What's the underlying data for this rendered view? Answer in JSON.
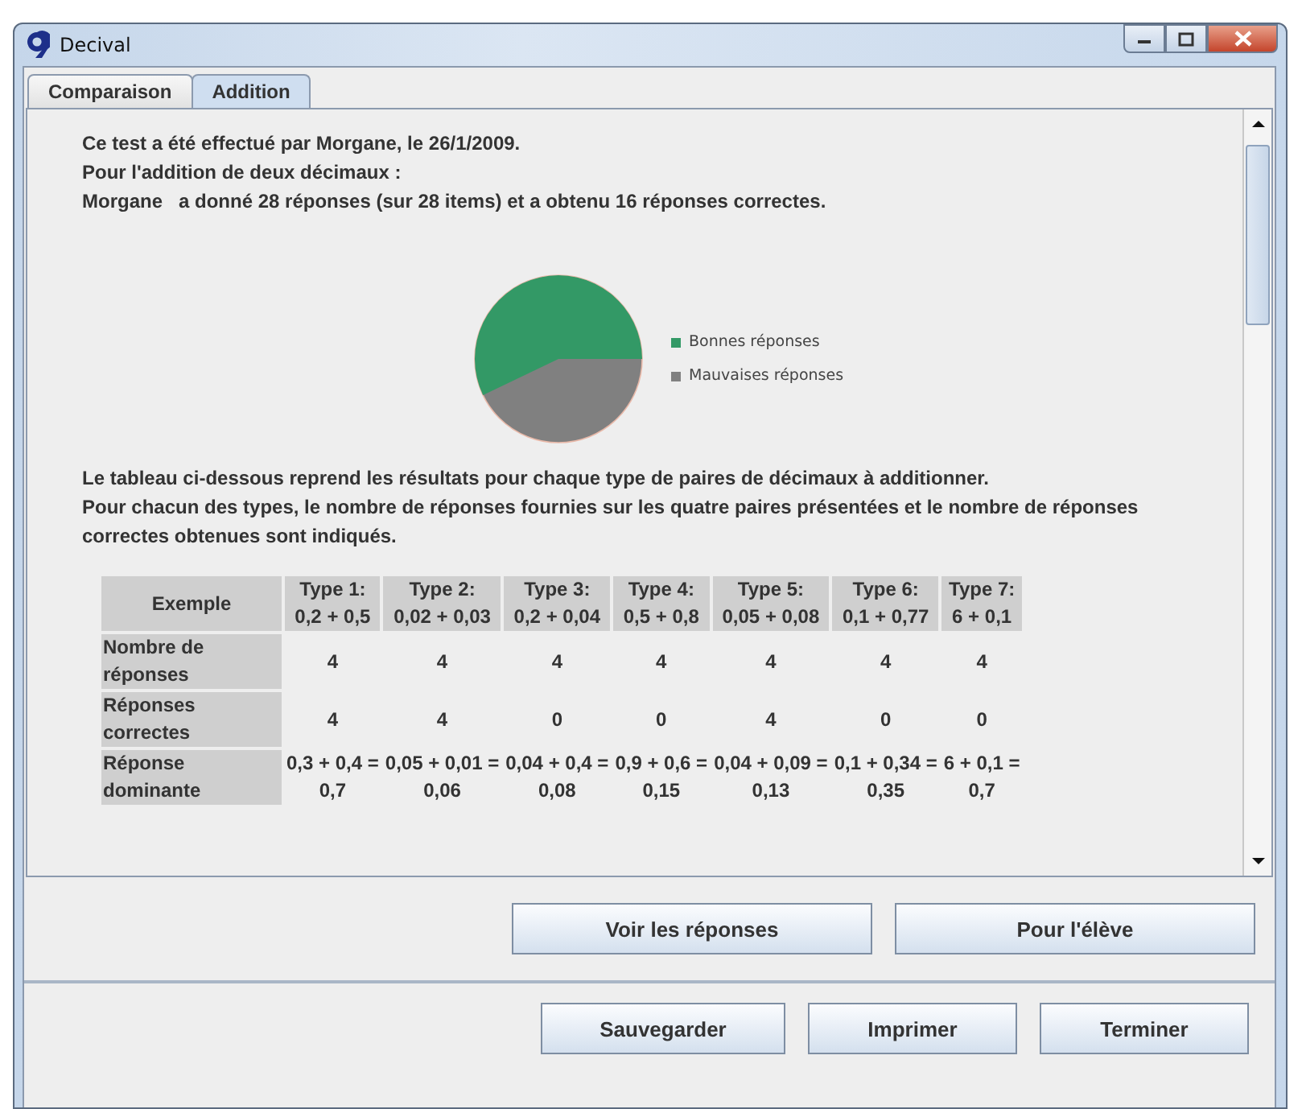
{
  "window": {
    "title": "Decival"
  },
  "tabs": [
    {
      "label": "Comparaison",
      "selected": false
    },
    {
      "label": "Addition",
      "selected": true
    }
  ],
  "intro": [
    "Ce test a été effectué par Morgane, le 26/1/2009.",
    "Pour l'addition de deux décimaux :",
    "Morgane   a donné 28 réponses (sur 28 items) et a obtenu 16 réponses correctes."
  ],
  "pie": {
    "legend": [
      {
        "label": "Bonnes réponses",
        "color": "#339966"
      },
      {
        "label": "Mauvaises réponses",
        "color": "#808080"
      }
    ]
  },
  "description": "Le tableau ci-dessous reprend les résultats pour chaque type de paires de décimaux à additionner.\nPour chacun des types, le nombre de réponses fournies sur les quatre paires présentées et le nombre de réponses correctes obtenues sont indiqués.",
  "table": {
    "columns": [
      "Exemple",
      "Type 1:\n0,2 + 0,5",
      "Type 2:\n0,02 + 0,03",
      "Type 3:\n0,2 + 0,04",
      "Type 4:\n0,5 + 0,8",
      "Type 5:\n0,05 + 0,08",
      "Type 6:\n0,1 + 0,77",
      "Type 7:\n6 + 0,1"
    ],
    "rows": [
      [
        "Nombre de réponses",
        "4",
        "4",
        "4",
        "4",
        "4",
        "4",
        "4"
      ],
      [
        "Réponses correctes",
        "4",
        "4",
        "0",
        "0",
        "4",
        "0",
        "0"
      ],
      [
        "Réponse dominante",
        "0,3 + 0,4 =\n0,7",
        "0,05 + 0,01 =\n0,06",
        "0,04 + 0,4 =\n0,08",
        "0,9 + 0,6 =\n0,15",
        "0,04 + 0,09 =\n0,13",
        "0,1 + 0,34 =\n0,35",
        "6 + 0,1 =\n0,7"
      ]
    ]
  },
  "action_buttons": [
    "Voir les réponses",
    "Pour l'élève"
  ],
  "footer_buttons": [
    "Sauvegarder",
    "Imprimer",
    "Terminer"
  ]
}
